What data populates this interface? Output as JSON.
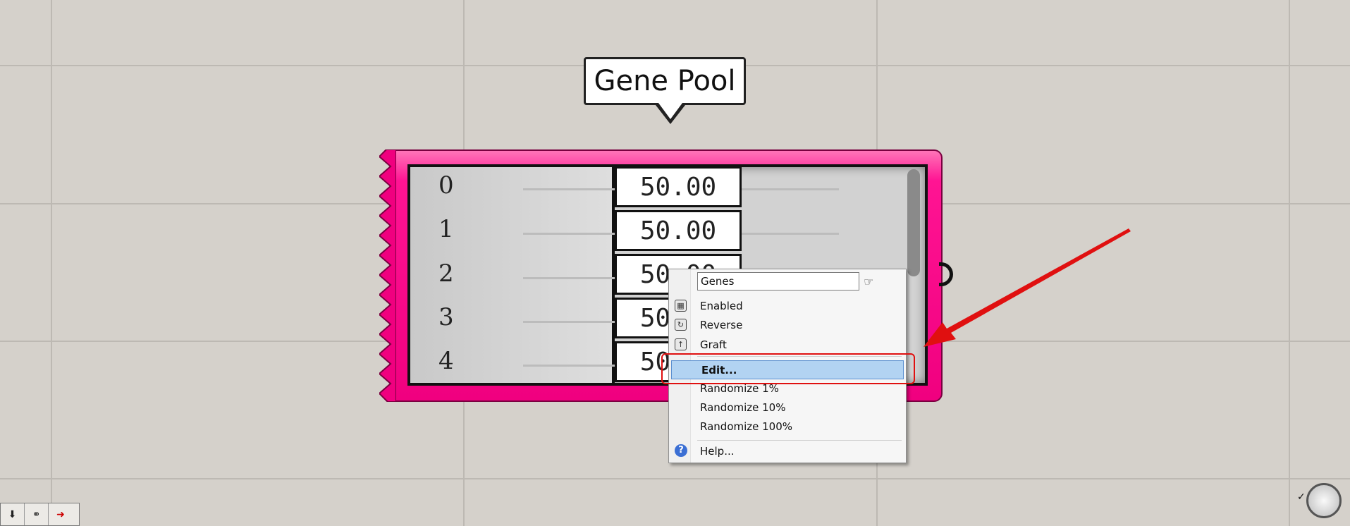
{
  "canvas": {
    "background": "#d5d1cb",
    "gridline_color": "#bdb9b3"
  },
  "tooltip": {
    "title": "Gene Pool"
  },
  "gene_pool": {
    "accent_color": "#ff1493",
    "rows": [
      {
        "index": "0",
        "value": "50.00"
      },
      {
        "index": "1",
        "value": "50.00"
      },
      {
        "index": "2",
        "value": "50.00"
      },
      {
        "index": "3",
        "value": "50.00"
      },
      {
        "index": "4",
        "value": "50.00"
      }
    ]
  },
  "context_menu": {
    "name_value": "Genes",
    "items": {
      "enabled": "Enabled",
      "reverse": "Reverse",
      "graft": "Graft",
      "edit": "Edit...",
      "randomize_1": "Randomize 1%",
      "randomize_10": "Randomize 10%",
      "randomize_100": "Randomize 100%",
      "help": "Help..."
    },
    "highlight_color": "#b2d3f2"
  },
  "annotation": {
    "color": "#e01010"
  },
  "bottom_toolbar": {
    "icons": [
      "download-icon",
      "glasses-icon",
      "transfer-icon"
    ]
  }
}
